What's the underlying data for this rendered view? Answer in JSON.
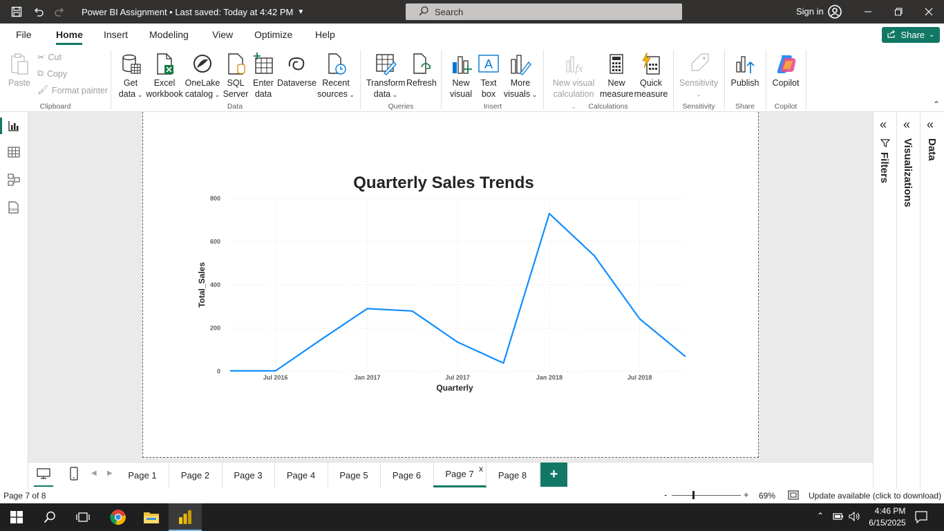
{
  "titlebar": {
    "doc_title": "Power BI Assignment • Last saved: Today at 4:42 PM",
    "search_placeholder": "Search",
    "signin_label": "Sign in"
  },
  "menubar": {
    "items": [
      "File",
      "Home",
      "Insert",
      "Modeling",
      "View",
      "Optimize",
      "Help"
    ],
    "active": "Home",
    "share_label": "Share"
  },
  "ribbon": {
    "clipboard": {
      "paste": "Paste",
      "cut": "Cut",
      "copy": "Copy",
      "format_painter": "Format painter",
      "group": "Clipboard"
    },
    "data": {
      "get_data_1": "Get",
      "get_data_2": "data",
      "excel_1": "Excel",
      "excel_2": "workbook",
      "onelake_1": "OneLake",
      "onelake_2": "catalog",
      "sql_1": "SQL",
      "sql_2": "Server",
      "enter_1": "Enter",
      "enter_2": "data",
      "dataverse": "Dataverse",
      "recent_1": "Recent",
      "recent_2": "sources",
      "group": "Data"
    },
    "queries": {
      "transform_1": "Transform",
      "transform_2": "data",
      "refresh": "Refresh",
      "group": "Queries"
    },
    "insert": {
      "new_visual_1": "New",
      "new_visual_2": "visual",
      "text_box_1": "Text",
      "text_box_2": "box",
      "more_visuals_1": "More",
      "more_visuals_2": "visuals",
      "group": "Insert"
    },
    "calculations": {
      "new_visual_calc_1": "New visual",
      "new_visual_calc_2": "calculation",
      "new_measure_1": "New",
      "new_measure_2": "measure",
      "quick_measure_1": "Quick",
      "quick_measure_2": "measure",
      "group": "Calculations"
    },
    "sensitivity": {
      "label": "Sensitivity",
      "group": "Sensitivity"
    },
    "share": {
      "publish": "Publish",
      "group": "Share"
    },
    "copilot": {
      "label": "Copilot",
      "group": "Copilot"
    }
  },
  "panes": {
    "filters": "Filters",
    "visualizations": "Visualizations",
    "data": "Data"
  },
  "chart_data": {
    "type": "line",
    "title": "Quarterly Sales Trends",
    "xlabel": "Quarterly",
    "ylabel": "Total_Sales",
    "x": [
      "2016-04-01",
      "2016-07-01",
      "2016-10-01",
      "2017-01-01",
      "2017-04-01",
      "2017-07-01",
      "2017-10-01",
      "2018-01-01",
      "2018-04-01",
      "2018-07-01",
      "2018-10-01"
    ],
    "series": [
      {
        "values": [
          2,
          2,
          148,
          290,
          279,
          135,
          38,
          730,
          535,
          243,
          68
        ]
      }
    ],
    "x_ticks": [
      "Jul 2016",
      "Jan 2017",
      "Jul 2017",
      "Jan 2018",
      "Jul 2018"
    ],
    "y_ticks": [
      "0",
      "200",
      "400",
      "600",
      "800"
    ],
    "ylim": [
      0,
      800
    ],
    "grid": true,
    "line_color": "#118DFF"
  },
  "tabs": {
    "pages": [
      "Page 1",
      "Page 2",
      "Page 3",
      "Page 4",
      "Page 5",
      "Page 6",
      "Page 7",
      "Page 8"
    ],
    "active": "Page 7",
    "close_glyph": "x",
    "add_glyph": "+"
  },
  "statusbar": {
    "page_indicator": "Page 7 of 8",
    "zoom_minus": "-",
    "zoom_plus": "+",
    "zoom_level": "69%",
    "update_text": "Update available (click to download)"
  },
  "taskbar": {
    "time": "4:46 PM",
    "date": "6/15/2025"
  }
}
